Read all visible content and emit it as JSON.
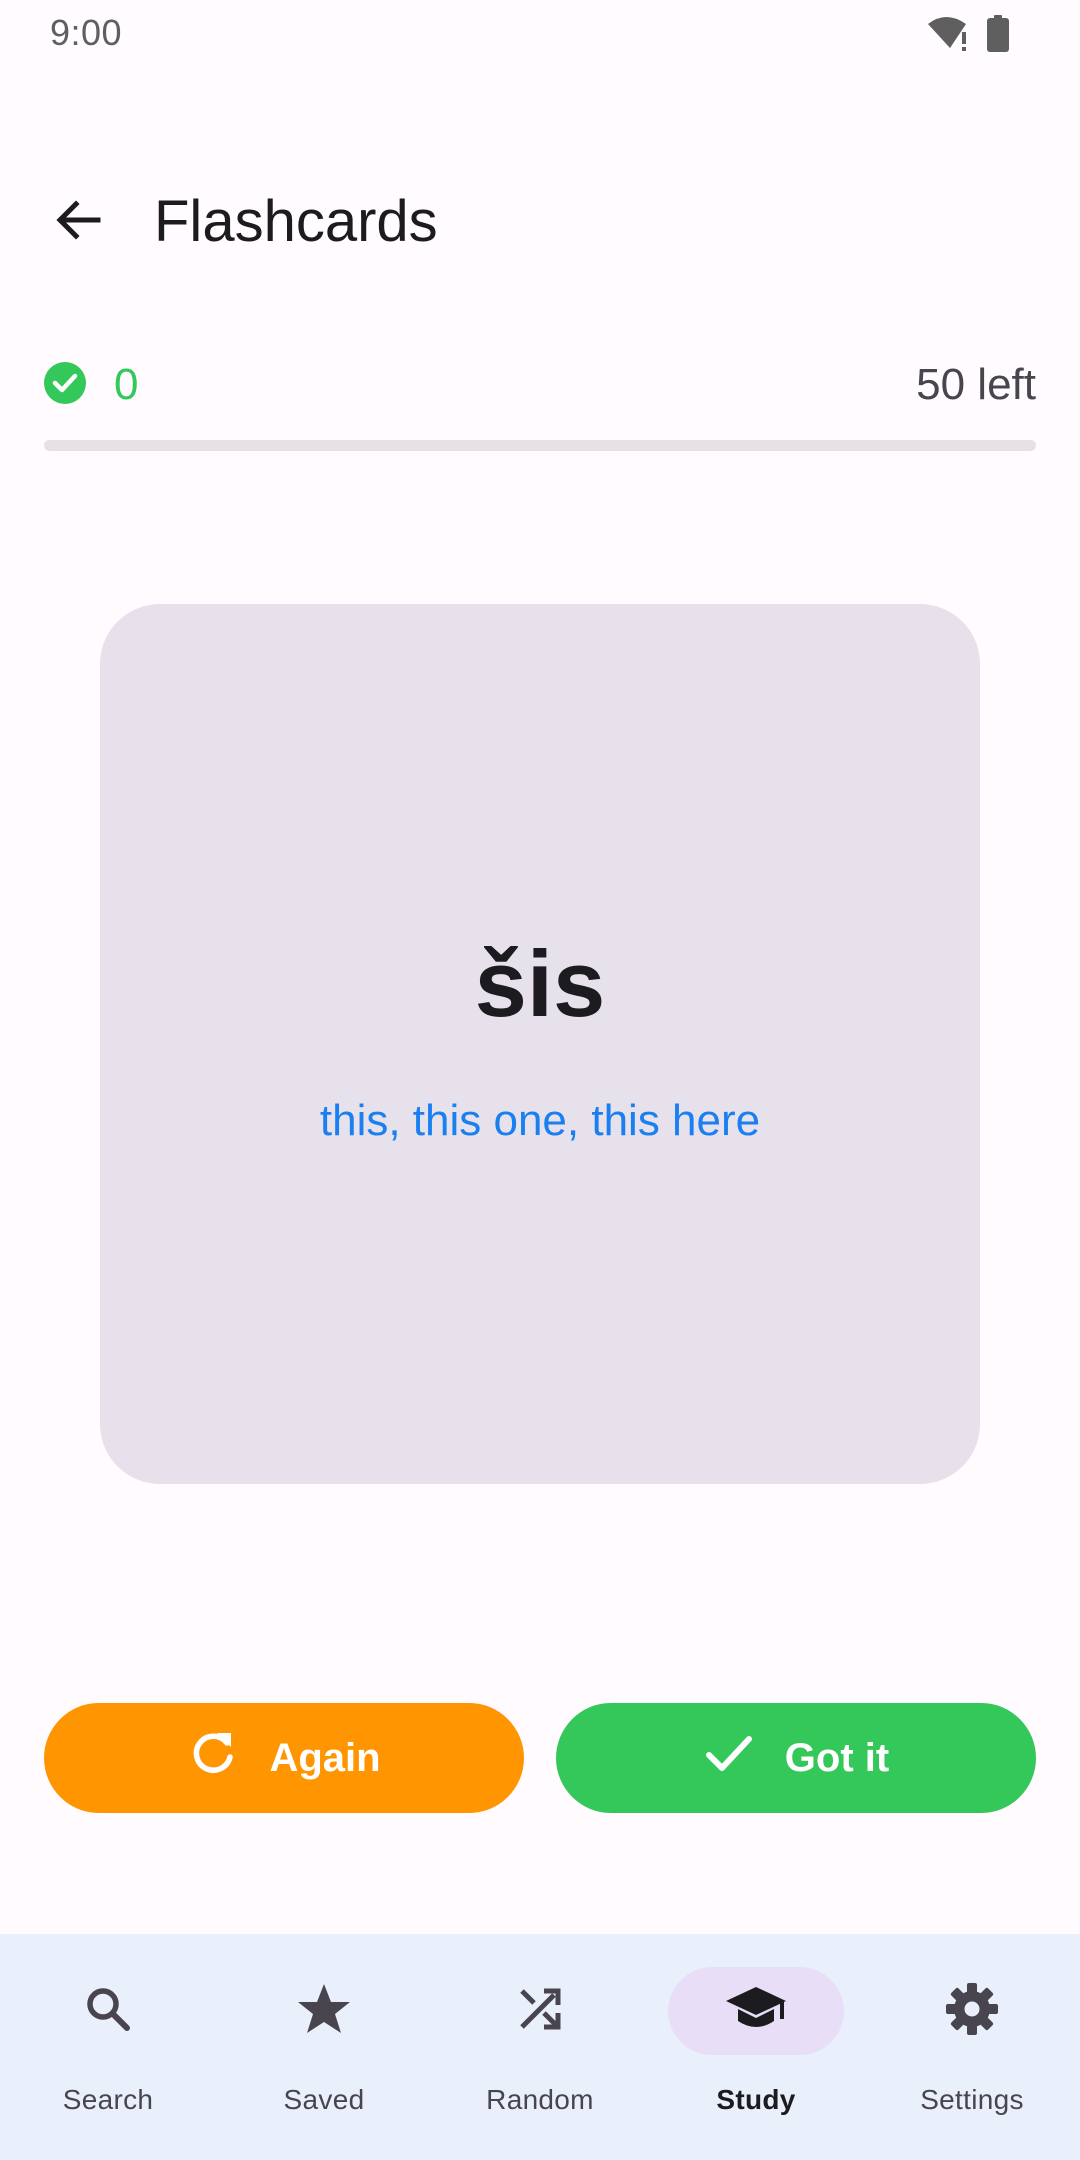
{
  "status_bar": {
    "time": "9:00",
    "icons": [
      "wifi-alert-icon",
      "battery-icon"
    ]
  },
  "app_bar": {
    "back_icon": "arrow-back-icon",
    "title": "Flashcards"
  },
  "progress": {
    "correct_count": "0",
    "left_label": "50 left",
    "fraction_complete": 0
  },
  "card": {
    "word": "šis",
    "translation": "this, this one, this here"
  },
  "actions": {
    "again_label": "Again",
    "got_it_label": "Got it"
  },
  "bottom_nav": {
    "items": [
      {
        "label": "Search",
        "icon": "search-icon",
        "active": false
      },
      {
        "label": "Saved",
        "icon": "star-icon",
        "active": false
      },
      {
        "label": "Random",
        "icon": "shuffle-icon",
        "active": false
      },
      {
        "label": "Study",
        "icon": "school-icon",
        "active": true
      },
      {
        "label": "Settings",
        "icon": "gear-icon",
        "active": false
      }
    ]
  },
  "colors": {
    "correct_green": "#34c759",
    "again_orange": "#ff9500",
    "translation_blue": "#1a7ff0",
    "card_background": "#e6e1ea",
    "nav_background": "#eaf0fb",
    "active_pill": "#e8def8"
  }
}
